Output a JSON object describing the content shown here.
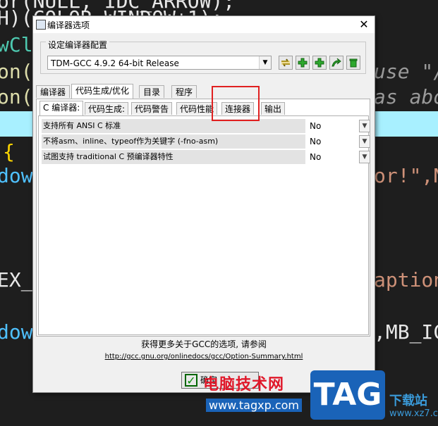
{
  "background_code": {
    "lines": [
      "or(NULL, IDC_ARROW);",
      "H)(COLOR_WINDOW+1);",
      "wCla",
      "on(",
      "on(",
      "{",
      "dow",
      "EX_",
      "dow"
    ],
    "right_fragments": [
      "use \"/",
      "as abo",
      "or!\",N",
      "aption",
      ",MB_IC"
    ]
  },
  "dialog": {
    "title": "编译器选项",
    "close_label": "✕",
    "group_label": "设定编译器配置",
    "compiler_selected": "TDM-GCC 4.9.2 64-bit Release",
    "top_tabs": [
      "编译器",
      "代码生成/优化",
      "目录",
      "程序"
    ],
    "sub_tabs": [
      "C 编译器:",
      "代码生成:",
      "代码警告",
      "代码性能",
      "连接器",
      "输出"
    ],
    "options": [
      {
        "label": "支持所有 ANSI C 标准",
        "value": "No"
      },
      {
        "label": "不将asm、inline、typeof作为关键字 (-fno-asm)",
        "value": "No"
      },
      {
        "label": "试图支持 traditional C 预编译器特性",
        "value": "No"
      }
    ],
    "more_info_text": "获得更多关于GCC的选项, 请参阅",
    "more_info_link": "http://gcc.gnu.org/onlinedocs/gcc/Option-Summary.html",
    "ok_label": "确定"
  },
  "watermark": {
    "brand_cn": "电脑技术网",
    "site_url": "www.tagxp.com",
    "tag_logo": "TAG",
    "right_site": "下载站",
    "right_url": "www.xz7.com"
  },
  "colors": {
    "highlight_box": "#e02020",
    "watermark_blue": "#1a63b8",
    "editor_background": "#1e1e1e"
  }
}
